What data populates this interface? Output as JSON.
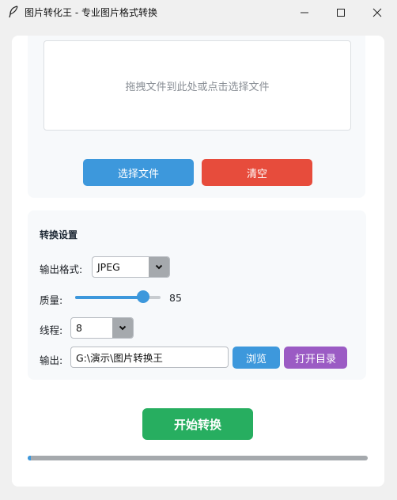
{
  "window": {
    "title": "图片转化王 - 专业图片格式转换",
    "icon": "feather-icon"
  },
  "drop_zone": {
    "hint": "拖拽文件到此处或点击选择文件"
  },
  "file_buttons": {
    "select_label": "选择文件",
    "clear_label": "清空"
  },
  "settings": {
    "title": "转换设置",
    "format": {
      "label": "输出格式:",
      "value": "JPEG"
    },
    "quality": {
      "label": "质量:",
      "value": 85,
      "min": 1,
      "max": 100
    },
    "threads": {
      "label": "线程:",
      "value": "8"
    },
    "output": {
      "label": "输出:",
      "path": "G:\\演示\\图片转换王",
      "browse_label": "浏览",
      "open_dir_label": "打开目录"
    }
  },
  "start_label": "开始转换",
  "progress": {
    "value": 0.01
  },
  "colors": {
    "primary": "#3d98dc",
    "danger": "#e74c3c",
    "success": "#27ae60",
    "purple": "#9b5bc4"
  }
}
